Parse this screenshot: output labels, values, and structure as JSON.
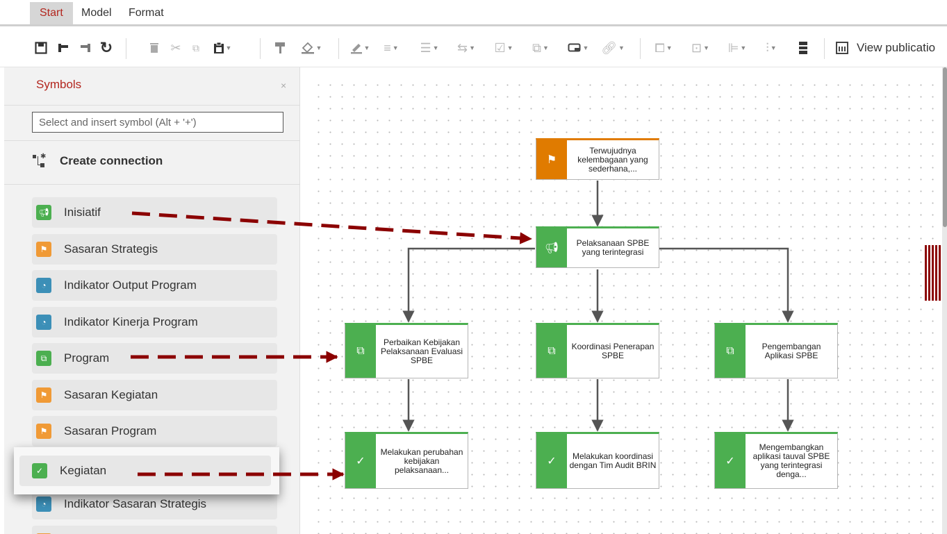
{
  "menu": {
    "tabs": [
      {
        "label": "Start",
        "active": true
      },
      {
        "label": "Model",
        "active": false
      },
      {
        "label": "Format",
        "active": false
      }
    ]
  },
  "toolbar": {
    "view_publication_label": "View publicatio"
  },
  "symbols_panel": {
    "title": "Symbols",
    "close_glyph": "×",
    "search_placeholder": "Select and insert symbol (Alt + '+')",
    "create_connection_label": "Create connection",
    "items": [
      {
        "label": "Inisiatif",
        "color": "#4caf50",
        "icon": "megaphone-icon"
      },
      {
        "label": "Sasaran Strategis",
        "color": "#f09a36",
        "icon": "flag-icon"
      },
      {
        "label": "Indikator Output Program",
        "color": "#3c8fb7",
        "icon": "gauge-icon"
      },
      {
        "label": "Indikator Kinerja Program",
        "color": "#3c8fb7",
        "icon": "gauge-icon"
      },
      {
        "label": "Program",
        "color": "#4caf50",
        "icon": "program-stack-icon"
      },
      {
        "label": "Sasaran Kegiatan",
        "color": "#f09a36",
        "icon": "target-flag-icon"
      },
      {
        "label": "Sasaran Program",
        "color": "#f09a36",
        "icon": "target-flag-icon"
      },
      {
        "label": "Kegiatan",
        "color": "#4caf50",
        "icon": "clipboard-check-icon"
      },
      {
        "label": "Indikator Sasaran Strategis",
        "color": "#3c8fb7",
        "icon": "gauge-icon"
      }
    ]
  },
  "diagram": {
    "nodes": {
      "goal": "Terwujudnya kelembagaan yang sederhana,...",
      "initiative": "Pelaksanaan SPBE yang terintegrasi",
      "program_1": "Perbaikan Kebijakan Pelaksanaan Evaluasi SPBE",
      "program_2": "Koordinasi Penerapan SPBE",
      "program_3": "Pengembangan Aplikasi SPBE",
      "activity_1": "Melakukan perubahan kebijakan pelaksanaan...",
      "activity_2": "Melakukan koordinasi dengan Tim Audit BRIN",
      "activity_3": "Mengembangkan aplikasi tauval SPBE yang terintegrasi denga..."
    }
  },
  "colors": {
    "accent_red": "#b3261e",
    "annotation_arrow": "#8b0000",
    "node_green": "#4caf50",
    "node_orange": "#e07b00"
  }
}
